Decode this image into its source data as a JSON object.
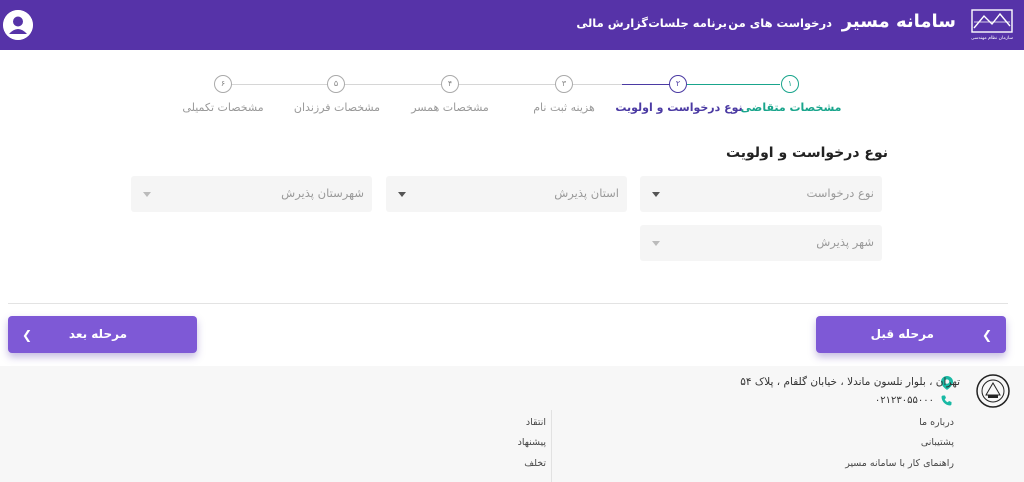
{
  "header": {
    "app_title": "سامانه مسیر",
    "nav": [
      "درخواست های من",
      "برنامه جلسات",
      "گزارش مالی"
    ],
    "logo_caption": "سازمان نظام مهندسی"
  },
  "steps": [
    {
      "num": "۱",
      "label": "مشخصات متقاضی",
      "state": "done"
    },
    {
      "num": "۲",
      "label": "نوع درخواست و اولویت",
      "state": "active"
    },
    {
      "num": "۳",
      "label": "هزینه ثبت نام",
      "state": "pending"
    },
    {
      "num": "۴",
      "label": "مشخصات همسر",
      "state": "pending"
    },
    {
      "num": "۵",
      "label": "مشخصات فرزندان",
      "state": "pending"
    },
    {
      "num": "۶",
      "label": "مشخصات تکمیلی",
      "state": "pending"
    }
  ],
  "form": {
    "title": "نوع درخواست و اولویت",
    "request_type_placeholder": "نوع درخواست",
    "province_placeholder": "استان پذیرش",
    "county_placeholder": "شهرستان پذیرش",
    "city_placeholder": "شهر پذیرش"
  },
  "buttons": {
    "prev_label": "مرحله قبل",
    "next_label": "مرحله بعد"
  },
  "footer": {
    "address": "تهران ، بلوار نلسون ماندلا ، خیابان گلفام ، پلاک ۵۴",
    "phone": "۰۲۱۲۳۰۵۵۰۰۰",
    "links_right": [
      "درباره ما",
      "پشتیبانی",
      "راهنمای کار با سامانه مسیر"
    ],
    "links_left": [
      "انتقاد",
      "پیشنهاد",
      "تخلف"
    ]
  },
  "colors": {
    "primary": "#5633a8",
    "button": "#7e59d6",
    "step_done": "#19a58c",
    "step_active": "#4b3aa3"
  }
}
